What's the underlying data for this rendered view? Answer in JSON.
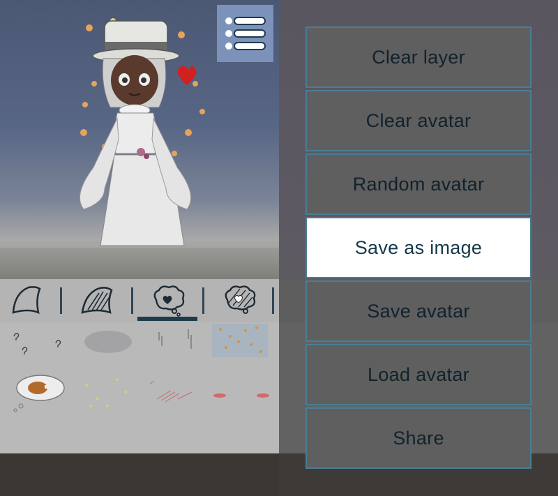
{
  "menu": {
    "items": [
      {
        "label": "Clear layer",
        "highlighted": false
      },
      {
        "label": "Clear avatar",
        "highlighted": false
      },
      {
        "label": "Random avatar",
        "highlighted": false
      },
      {
        "label": "Save as image",
        "highlighted": true
      },
      {
        "label": "Save avatar",
        "highlighted": false
      },
      {
        "label": "Load avatar",
        "highlighted": false
      },
      {
        "label": "Share",
        "highlighted": false
      }
    ]
  },
  "toolbar": {
    "menu_icon": "list-icon",
    "categories": [
      {
        "icon": "hair-front-icon",
        "selected": false
      },
      {
        "icon": "hair-striped-icon",
        "selected": false
      },
      {
        "icon": "thought-bubble-heart-icon",
        "selected": true
      },
      {
        "icon": "thought-bubble-striped-icon",
        "selected": false
      }
    ]
  },
  "colors": {
    "menu_button": "#7c92bb",
    "menu_border": "#4a7e94",
    "highlight_bg": "#ffffff",
    "selected_underline": "#1f3b4a"
  }
}
